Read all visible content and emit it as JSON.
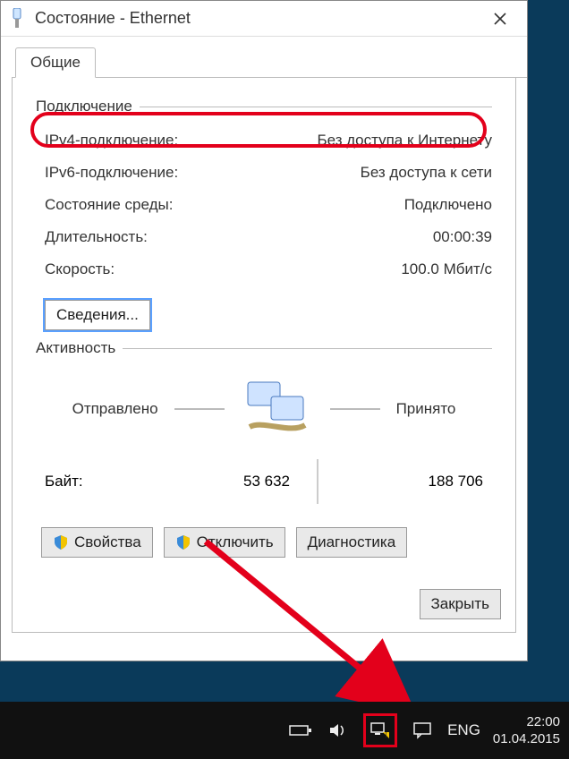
{
  "window": {
    "title": "Состояние - Ethernet",
    "tab_general": "Общие"
  },
  "connection": {
    "group_label": "Подключение",
    "ipv4_label": "IPv4-подключение:",
    "ipv4_value": "Без доступа к Интернету",
    "ipv6_label": "IPv6-подключение:",
    "ipv6_value": "Без доступа к сети",
    "media_label": "Состояние среды:",
    "media_value": "Подключено",
    "duration_label": "Длительность:",
    "duration_value": "00:00:39",
    "speed_label": "Скорость:",
    "speed_value": "100.0 Мбит/с",
    "details_button": "Сведения..."
  },
  "activity": {
    "group_label": "Активность",
    "sent_label": "Отправлено",
    "recv_label": "Принято",
    "bytes_label": "Байт:",
    "sent_bytes": "53 632",
    "recv_bytes": "188 706"
  },
  "buttons": {
    "properties": "Свойства",
    "disable": "Отключить",
    "diagnose": "Диагностика",
    "close": "Закрыть"
  },
  "taskbar": {
    "lang": "ENG",
    "time": "22:00",
    "date": "01.04.2015"
  }
}
